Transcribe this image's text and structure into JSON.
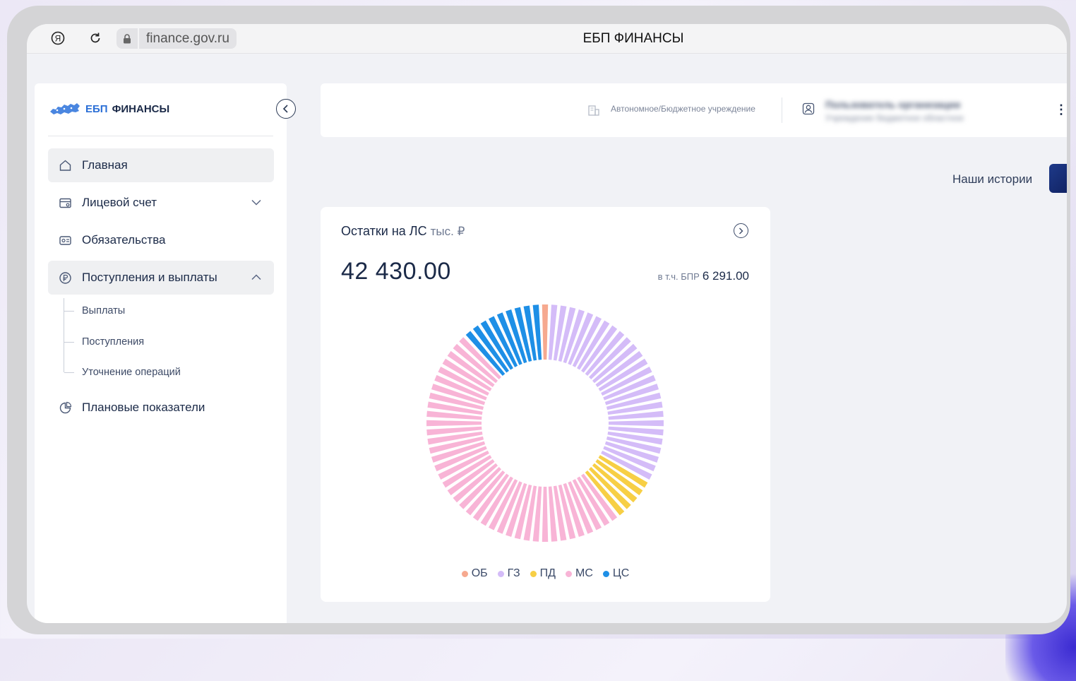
{
  "browser": {
    "url": "finance.gov.ru",
    "tab_title": "ЕБП ФИНАНСЫ"
  },
  "app": {
    "logo_part1": "ЕБП",
    "logo_part2": "ФИНАНСЫ"
  },
  "sidebar": {
    "items": [
      {
        "label": "Главная",
        "icon": "home-icon"
      },
      {
        "label": "Лицевой счет",
        "icon": "account-card-icon"
      },
      {
        "label": "Обязательства",
        "icon": "obligations-icon"
      },
      {
        "label": "Поступления и выплаты",
        "icon": "ruble-circle-icon"
      },
      {
        "label": "Плановые показатели",
        "icon": "pie-chart-icon"
      }
    ],
    "subitems": [
      "Выплаты",
      "Поступления",
      "Уточнение операций"
    ]
  },
  "header": {
    "org_type": "Автономное/Бюджетное учреждение",
    "user_line1": "Пользователь организации",
    "user_line2": "Учреждение бюджетное областное"
  },
  "stories": {
    "label": "Наши истории"
  },
  "card": {
    "title": "Остатки на ЛС",
    "unit": "тыс. ₽",
    "total": "42 430.00",
    "bpr_prefix": "в т.ч. БПР",
    "bpr_value": "6 291.00"
  },
  "colors": {
    "ОБ": "#f6a98f",
    "ГЗ": "#d4bcf8",
    "ПД": "#f7cf45",
    "МС": "#f8b4d6",
    "ЦС": "#1e8fe6"
  },
  "chart_data": {
    "type": "pie",
    "categories": [
      "ОБ",
      "ГЗ",
      "ПД",
      "МС",
      "ЦС"
    ],
    "values": [
      1,
      26,
      5,
      39,
      9
    ],
    "legend": "bottom"
  }
}
